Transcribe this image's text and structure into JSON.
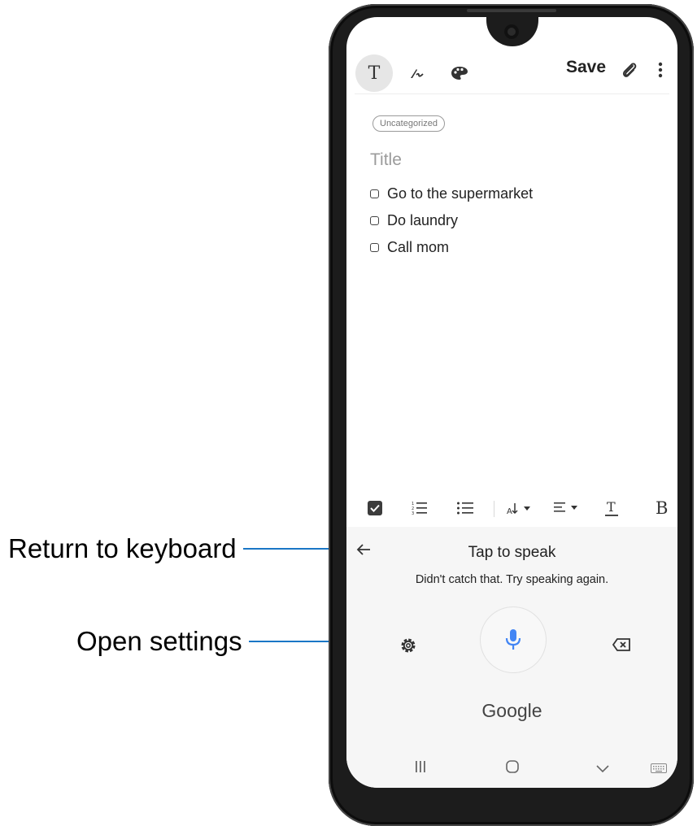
{
  "callouts": {
    "return_to_keyboard": "Return to keyboard",
    "open_settings": "Open settings"
  },
  "app_toolbar": {
    "text_mode_label": "T",
    "save_label": "Save",
    "icons": [
      "handwriting-pen-icon",
      "palette-icon",
      "attach-icon",
      "more-options-icon"
    ]
  },
  "note": {
    "category": "Uncategorized",
    "title_placeholder": "Title",
    "checklist": [
      {
        "text": "Go to the supermarket",
        "checked": false
      },
      {
        "text": "Do laundry",
        "checked": false
      },
      {
        "text": "Call mom",
        "checked": false
      }
    ]
  },
  "format_bar": {
    "bold_label": "B",
    "icons": [
      "checkbox-icon",
      "numbered-list-icon",
      "bulleted-list-icon",
      "font-size-icon",
      "align-icon",
      "text-color-icon",
      "bold-icon"
    ]
  },
  "voice_input": {
    "heading": "Tap to speak",
    "hint": "Didn't catch that. Try speaking again.",
    "brand": "Google",
    "accent_color": "#4285f4"
  },
  "colors": {
    "callout_line": "#1a76c6",
    "mic": "#4285f4"
  }
}
